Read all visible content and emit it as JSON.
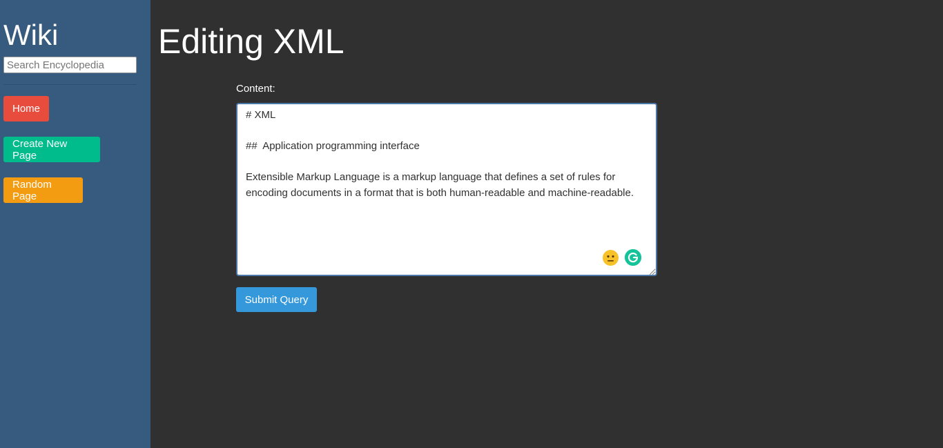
{
  "sidebar": {
    "title": "Wiki",
    "search_placeholder": "Search Encyclopedia",
    "nav": [
      {
        "label": "Home",
        "color": "#e74c3c"
      },
      {
        "label": "Create New Page",
        "color": "#00bc8c"
      },
      {
        "label": "Random Page",
        "color": "#f39c12"
      }
    ]
  },
  "main": {
    "title": "Editing XML",
    "form": {
      "content_label": "Content:",
      "content_value": "# XML\n\n##  Application programming interface\n\nExtensible Markup Language is a markup language that defines a set of rules for encoding documents in a format that is both human-readable and machine-readable.",
      "submit_label": "Submit Query"
    }
  },
  "icons": {
    "emoji": "neutral-face-emoji-icon",
    "grammarly": "grammarly-icon",
    "resize": "resize-handle-icon"
  },
  "colors": {
    "sidebar_bg": "#375a7f",
    "page_bg": "#303030",
    "submit": "#3498db"
  }
}
